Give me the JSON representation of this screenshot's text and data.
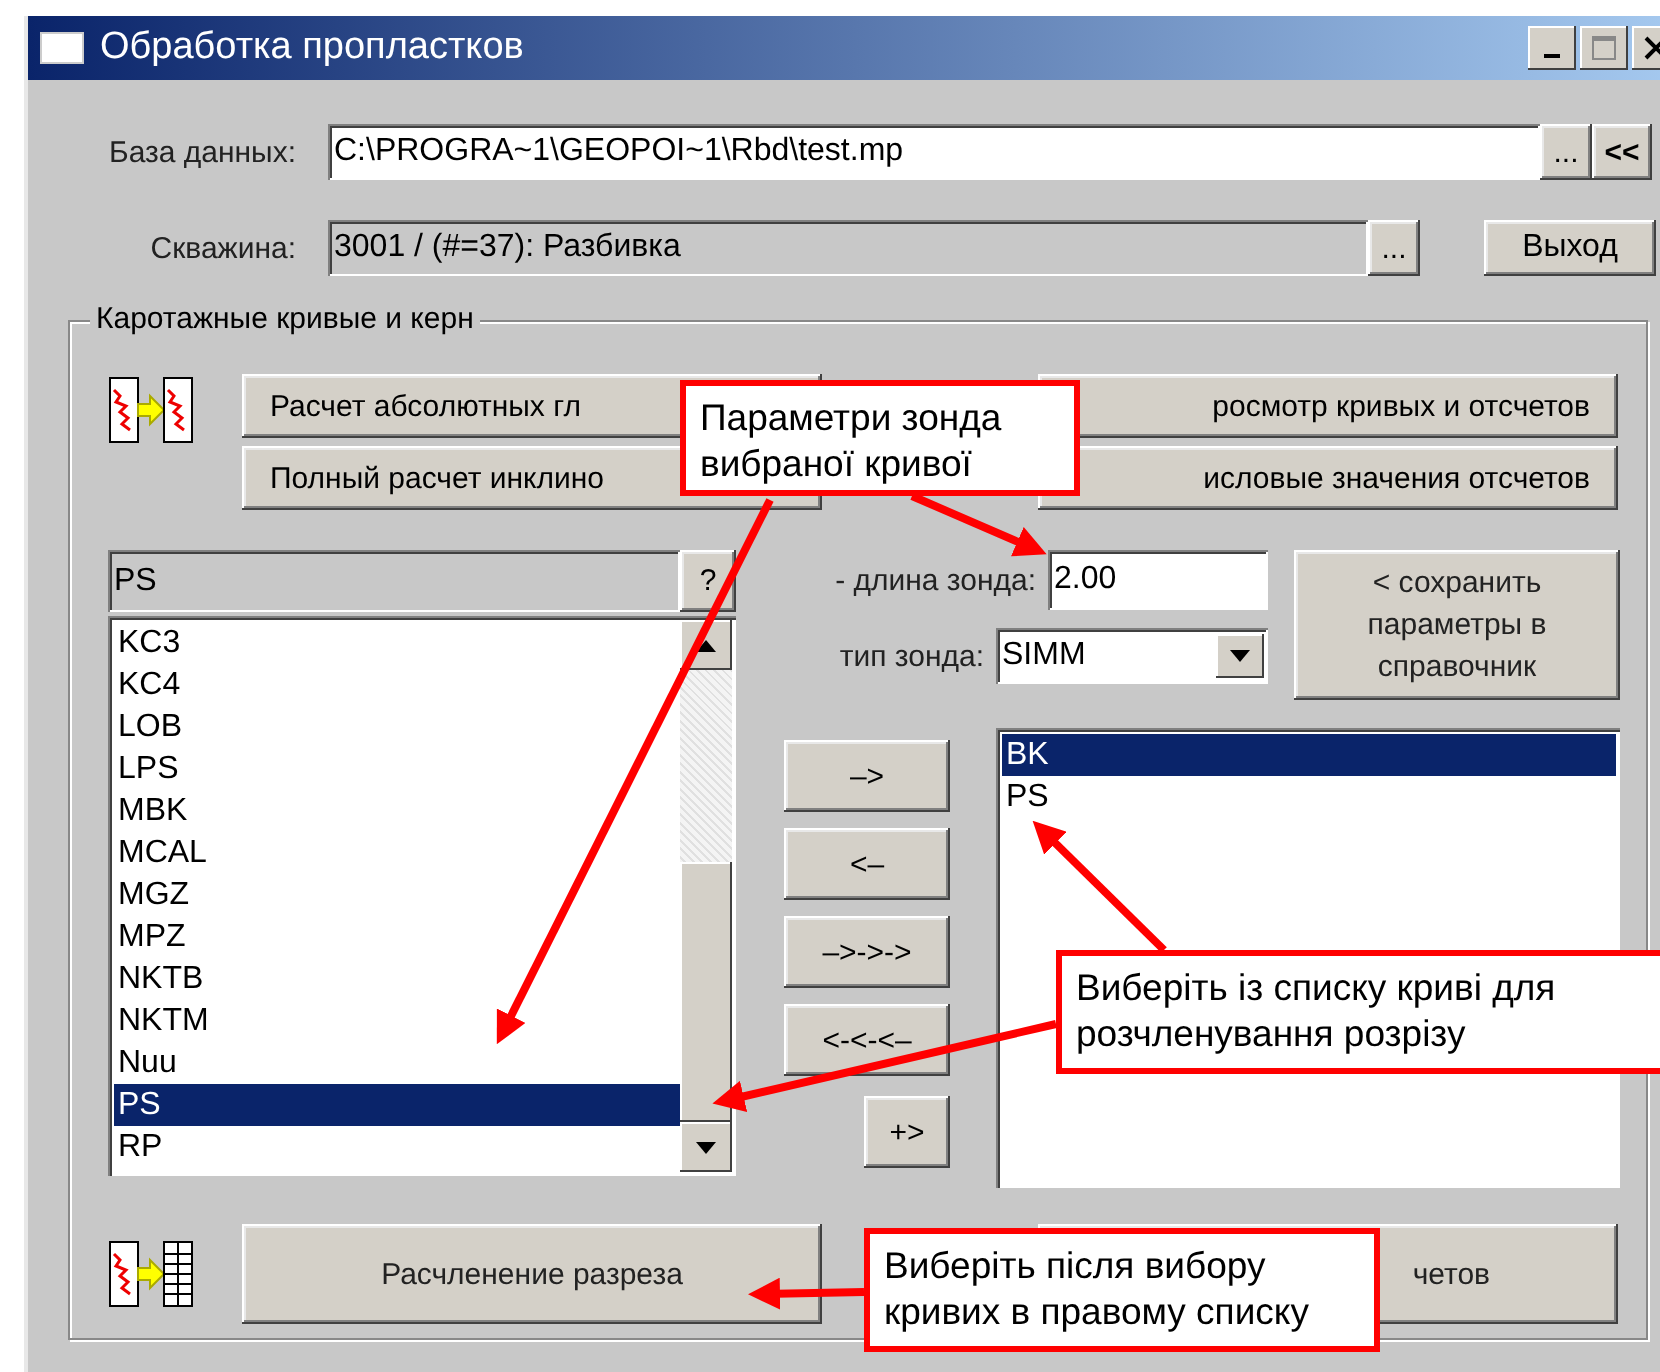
{
  "window": {
    "title": "Обработка пропластков"
  },
  "database": {
    "label": "База данных:",
    "value": "C:\\PROGRA~1\\GEOPOI~1\\Rbd\\test.mp",
    "buttons": [
      "...",
      "<<"
    ]
  },
  "well": {
    "label": "Скважина:",
    "value": "3001 /  (#=37): Разбивка",
    "browse_button": "...",
    "exit_button": "Выход"
  },
  "group": {
    "title": "Каротажные кривые и керн",
    "top_buttons": [
      "Расчет абсолютных гл",
      "росмотр кривых и отсчетов",
      "Полный расчет инклино",
      "исловые значения отсчетов"
    ],
    "curve_field": {
      "value": "PS",
      "help_button": "?"
    },
    "available_curves": [
      {
        "label": "KC3",
        "selected": false
      },
      {
        "label": "KC4",
        "selected": false
      },
      {
        "label": "LOB",
        "selected": false
      },
      {
        "label": "LPS",
        "selected": false
      },
      {
        "label": "MBK",
        "selected": false
      },
      {
        "label": "MCAL",
        "selected": false
      },
      {
        "label": "MGZ",
        "selected": false
      },
      {
        "label": "MPZ",
        "selected": false
      },
      {
        "label": "NKTB",
        "selected": false
      },
      {
        "label": "NKTM",
        "selected": false
      },
      {
        "label": "Nuu",
        "selected": false
      },
      {
        "label": "PS",
        "selected": true
      },
      {
        "label": "RP",
        "selected": false
      }
    ],
    "probe_length": {
      "label": "- длина зонда:",
      "value": "2.00"
    },
    "probe_type": {
      "label": "тип зонда:",
      "value": "SIMM"
    },
    "save_button": "< сохранить\nпараметры в\nсправочник",
    "move_buttons": [
      "–>",
      "<–",
      "–>->->",
      "<-<-<–",
      "+>"
    ],
    "selected_curves": [
      {
        "label": "BK",
        "selected": true
      },
      {
        "label": "PS",
        "selected": false
      }
    ],
    "split_button": "Расчленение разреза",
    "bottom_right_button": "четов"
  },
  "annotations": [
    {
      "text": "Параметри зонда вибраної кривої"
    },
    {
      "text": "Виберіть із списку криві для розчленування розрізу"
    },
    {
      "text": "Виберіть після вибору кривих в правому списку"
    }
  ]
}
